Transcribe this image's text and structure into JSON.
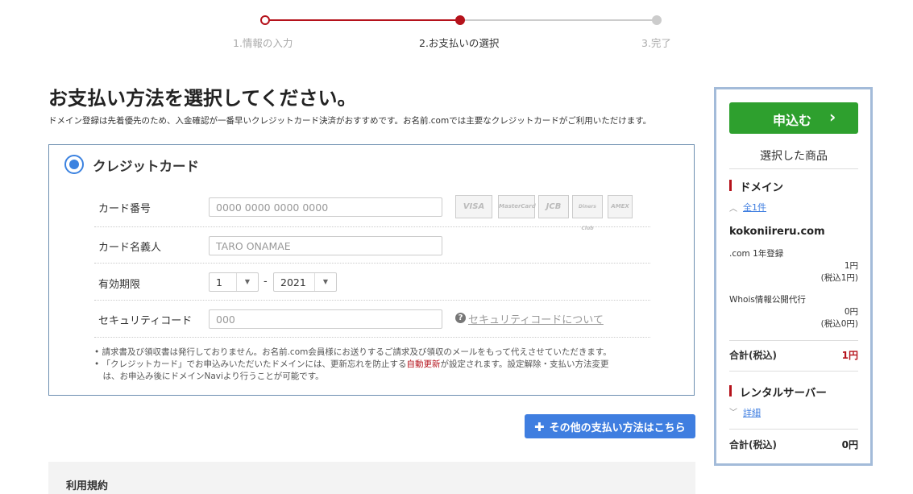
{
  "stepper": {
    "steps": [
      {
        "label": "1.情報の入力"
      },
      {
        "label": "2.お支払いの選択"
      },
      {
        "label": "3.完了"
      }
    ]
  },
  "main": {
    "title": "お支払い方法を選択してください。",
    "lead": "ドメイン登録は先着優先のため、入金確認が一番早いクレジットカード決済がおすすめです。お名前.comでは主要なクレジットカードがご利用いただけます。"
  },
  "credit_card": {
    "option_label": "クレジットカード",
    "card_number": {
      "label": "カード番号",
      "placeholder": "0000 0000 0000 0000"
    },
    "card_logos": [
      "VISA",
      "MasterCard",
      "JCB",
      "Diners Club",
      "AMEX"
    ],
    "card_holder": {
      "label": "カード名義人",
      "placeholder": "TARO ONAMAE"
    },
    "expiry": {
      "label": "有効期限",
      "month": "1",
      "separator": "-",
      "year": "2021"
    },
    "security_code": {
      "label": "セキュリティコード",
      "placeholder": "000",
      "help_link": "セキュリティコードについて"
    },
    "notes": {
      "line1": "• 請求書及び領収書は発行しておりません。お名前.com会員様にお送りするご請求及び領収のメールをもって代えさせていただきます。",
      "line2_a": "• 「クレジットカード」でお申込みいただいたドメインには、更新忘れを防止する",
      "line2_red": "自動更新",
      "line2_b": "が設定されます。設定解除・支払い方法変更",
      "line3": "　は、お申込み後にドメインNaviより行うことが可能です。"
    }
  },
  "other_payment_button": "その他の支払い方法はこちら",
  "terms_title": "利用規約",
  "sidebar": {
    "apply_button": "申込む",
    "selected_title": "選択した商品",
    "domain": {
      "category": "ドメイン",
      "toggle": "全1件",
      "name": "kokoniireru.com",
      "items": [
        {
          "name": ".com 1年登録",
          "price": "1円",
          "tax": "(税込1円)"
        },
        {
          "name": "Whois情報公開代行",
          "price": "0円",
          "tax": "(税込0円)"
        }
      ],
      "total_label": "合計(税込)",
      "total_value": "1円"
    },
    "server": {
      "category": "レンタルサーバー",
      "toggle": "詳細",
      "total_label": "合計(税込)",
      "total_value": "0円"
    }
  },
  "colors": {
    "brand_red": "#b5121b",
    "apply_green": "#2ea02e",
    "accent_blue": "#3f7ee0"
  }
}
